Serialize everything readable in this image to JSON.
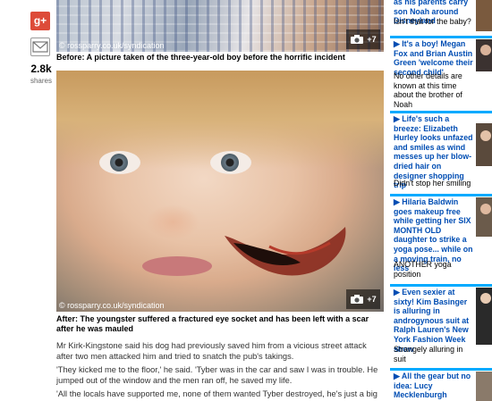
{
  "share": {
    "gplus_label": "g+",
    "count": "2.8k",
    "count_label": "shares"
  },
  "article": {
    "photo1": {
      "credit": "© rossparry.co.uk/syndication",
      "gallery_count": "+7"
    },
    "caption1": "Before: A picture taken of the three-year-old boy before the horrific incident",
    "photo2": {
      "credit": "© rossparry.co.uk/syndication",
      "gallery_count": "+7"
    },
    "caption2": "After: The youngster suffered a fractured eye socket and has been left with a scar after he was mauled",
    "paragraphs": [
      "Mr Kirk-Kingstone said his dog had previously saved him from a vicious street attack after two men attacked him and tried to snatch the pub's takings.",
      "'They kicked me to the floor,' he said. 'Tyber was in the car and saw I was in trouble. He jumped out of the window and the men ran off, he saved my life.",
      "'All the locals have supported me, none of them wanted Tyber destroyed, he's just a big softie.'"
    ]
  },
  "sidebar": {
    "items": [
      {
        "title": "as his parents carry son Noah around Disneyland",
        "sub": "Isn't that for the baby?"
      },
      {
        "title": "It's a boy! Megan Fox and Brian Austin Green 'welcome their second child'",
        "sub": "No other details are known at this time about the brother of Noah"
      },
      {
        "title": "Life's such a breeze: Elizabeth Hurley looks unfazed and smiles as wind messes up her blow-dried hair on designer shopping trip",
        "sub": "Didn't stop her smiling"
      },
      {
        "title": "Hilaria Baldwin goes makeup free while getting her SIX MONTH OLD daughter to strike a yoga pose... while on a moving train, no less",
        "sub": "ANOTHER yoga position"
      },
      {
        "title": "Even sexier at sixty! Kim Basinger is alluring in androgynous suit at Ralph Lauren's New York Fashion Week show",
        "sub": "Strangely alluring in suit"
      },
      {
        "title": "All the gear but no idea: Lucy Mecklenburgh niggles as she takes",
        "sub": ""
      }
    ],
    "arrow_glyph": "▶",
    "accent_color": "#00aaff",
    "link_color": "#004db3"
  }
}
